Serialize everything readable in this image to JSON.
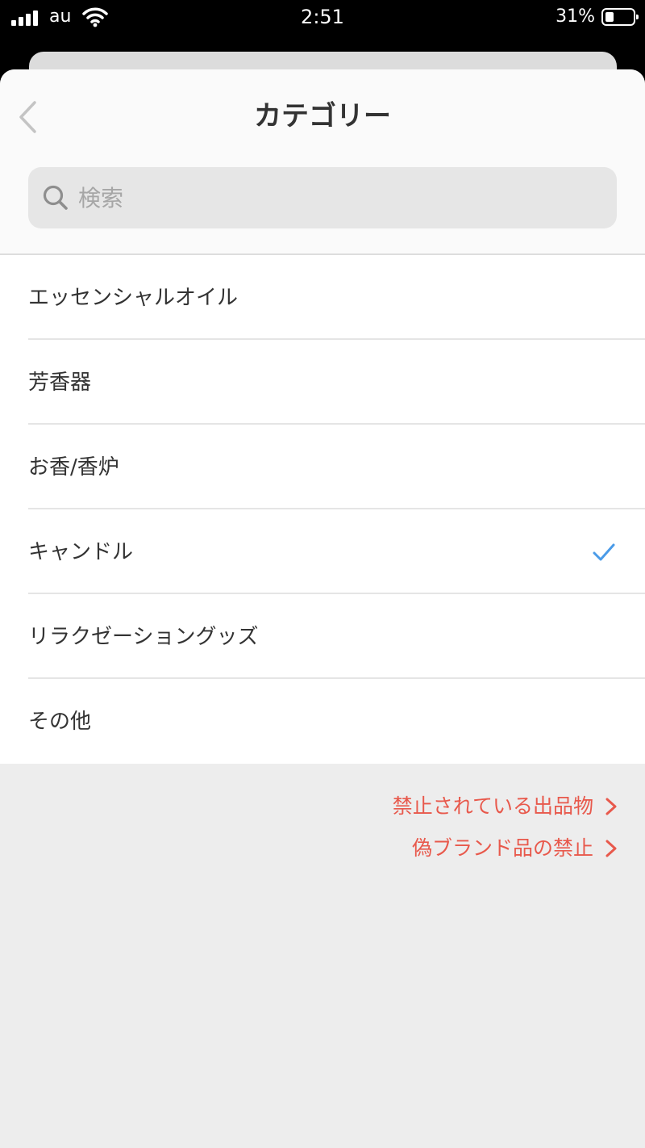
{
  "status_bar": {
    "carrier": "au",
    "time": "2:51",
    "battery": "31%",
    "battery_level": 0.31
  },
  "header": {
    "title": "カテゴリー",
    "back_icon": "chevron-left-icon"
  },
  "search": {
    "placeholder": "検索",
    "value": "",
    "icon": "search-icon"
  },
  "categories": [
    {
      "label": "エッセンシャルオイル",
      "selected": false
    },
    {
      "label": "芳香器",
      "selected": false
    },
    {
      "label": "お香/香炉",
      "selected": false
    },
    {
      "label": "キャンドル",
      "selected": true
    },
    {
      "label": "リラクゼーショングッズ",
      "selected": false
    },
    {
      "label": "その他",
      "selected": false
    }
  ],
  "footer_links": [
    {
      "label": "禁止されている出品物"
    },
    {
      "label": "偽ブランド品の禁止"
    }
  ],
  "colors": {
    "accent_check": "#4a9be8",
    "link": "#e8594c"
  }
}
